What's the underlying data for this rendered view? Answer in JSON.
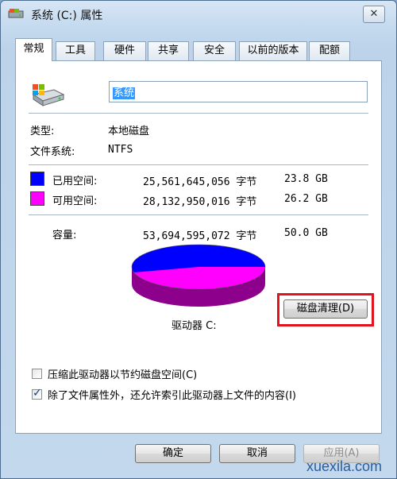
{
  "window": {
    "title": "系统 (C:) 属性",
    "close_label": "✕"
  },
  "tabs": [
    {
      "label": "常规",
      "active": true
    },
    {
      "label": "工具"
    },
    {
      "label": "硬件"
    },
    {
      "label": "共享"
    },
    {
      "label": "安全"
    },
    {
      "label": "以前的版本"
    },
    {
      "label": "配额"
    }
  ],
  "general": {
    "drive_name": "系统",
    "type_label": "类型:",
    "type_value": "本地磁盘",
    "fs_label": "文件系统:",
    "fs_value": "NTFS",
    "used": {
      "label": "已用空间:",
      "bytes": "25,561,645,056 字节",
      "size": "23.8 GB",
      "color": "#0000ff"
    },
    "free": {
      "label": "可用空间:",
      "bytes": "28,132,950,016 字节",
      "size": "26.2 GB",
      "color": "#ff00ff"
    },
    "capacity": {
      "label": "容量:",
      "bytes": "53,694,595,072 字节",
      "size": "50.0 GB"
    },
    "drive_label": "驱动器 C:",
    "cleanup_button": "磁盘清理(D)",
    "compress_option": {
      "label": "压缩此驱动器以节约磁盘空间(C)",
      "checked": false
    },
    "index_option": {
      "label": "除了文件属性外，还允许索引此驱动器上文件的内容(I)",
      "checked": true
    }
  },
  "footer": {
    "ok": "确定",
    "cancel": "取消",
    "apply": "应用(A)"
  },
  "watermark": "xuexila.com",
  "icons": {
    "title": "drive-icon",
    "drive": "hard-drive-icon"
  }
}
